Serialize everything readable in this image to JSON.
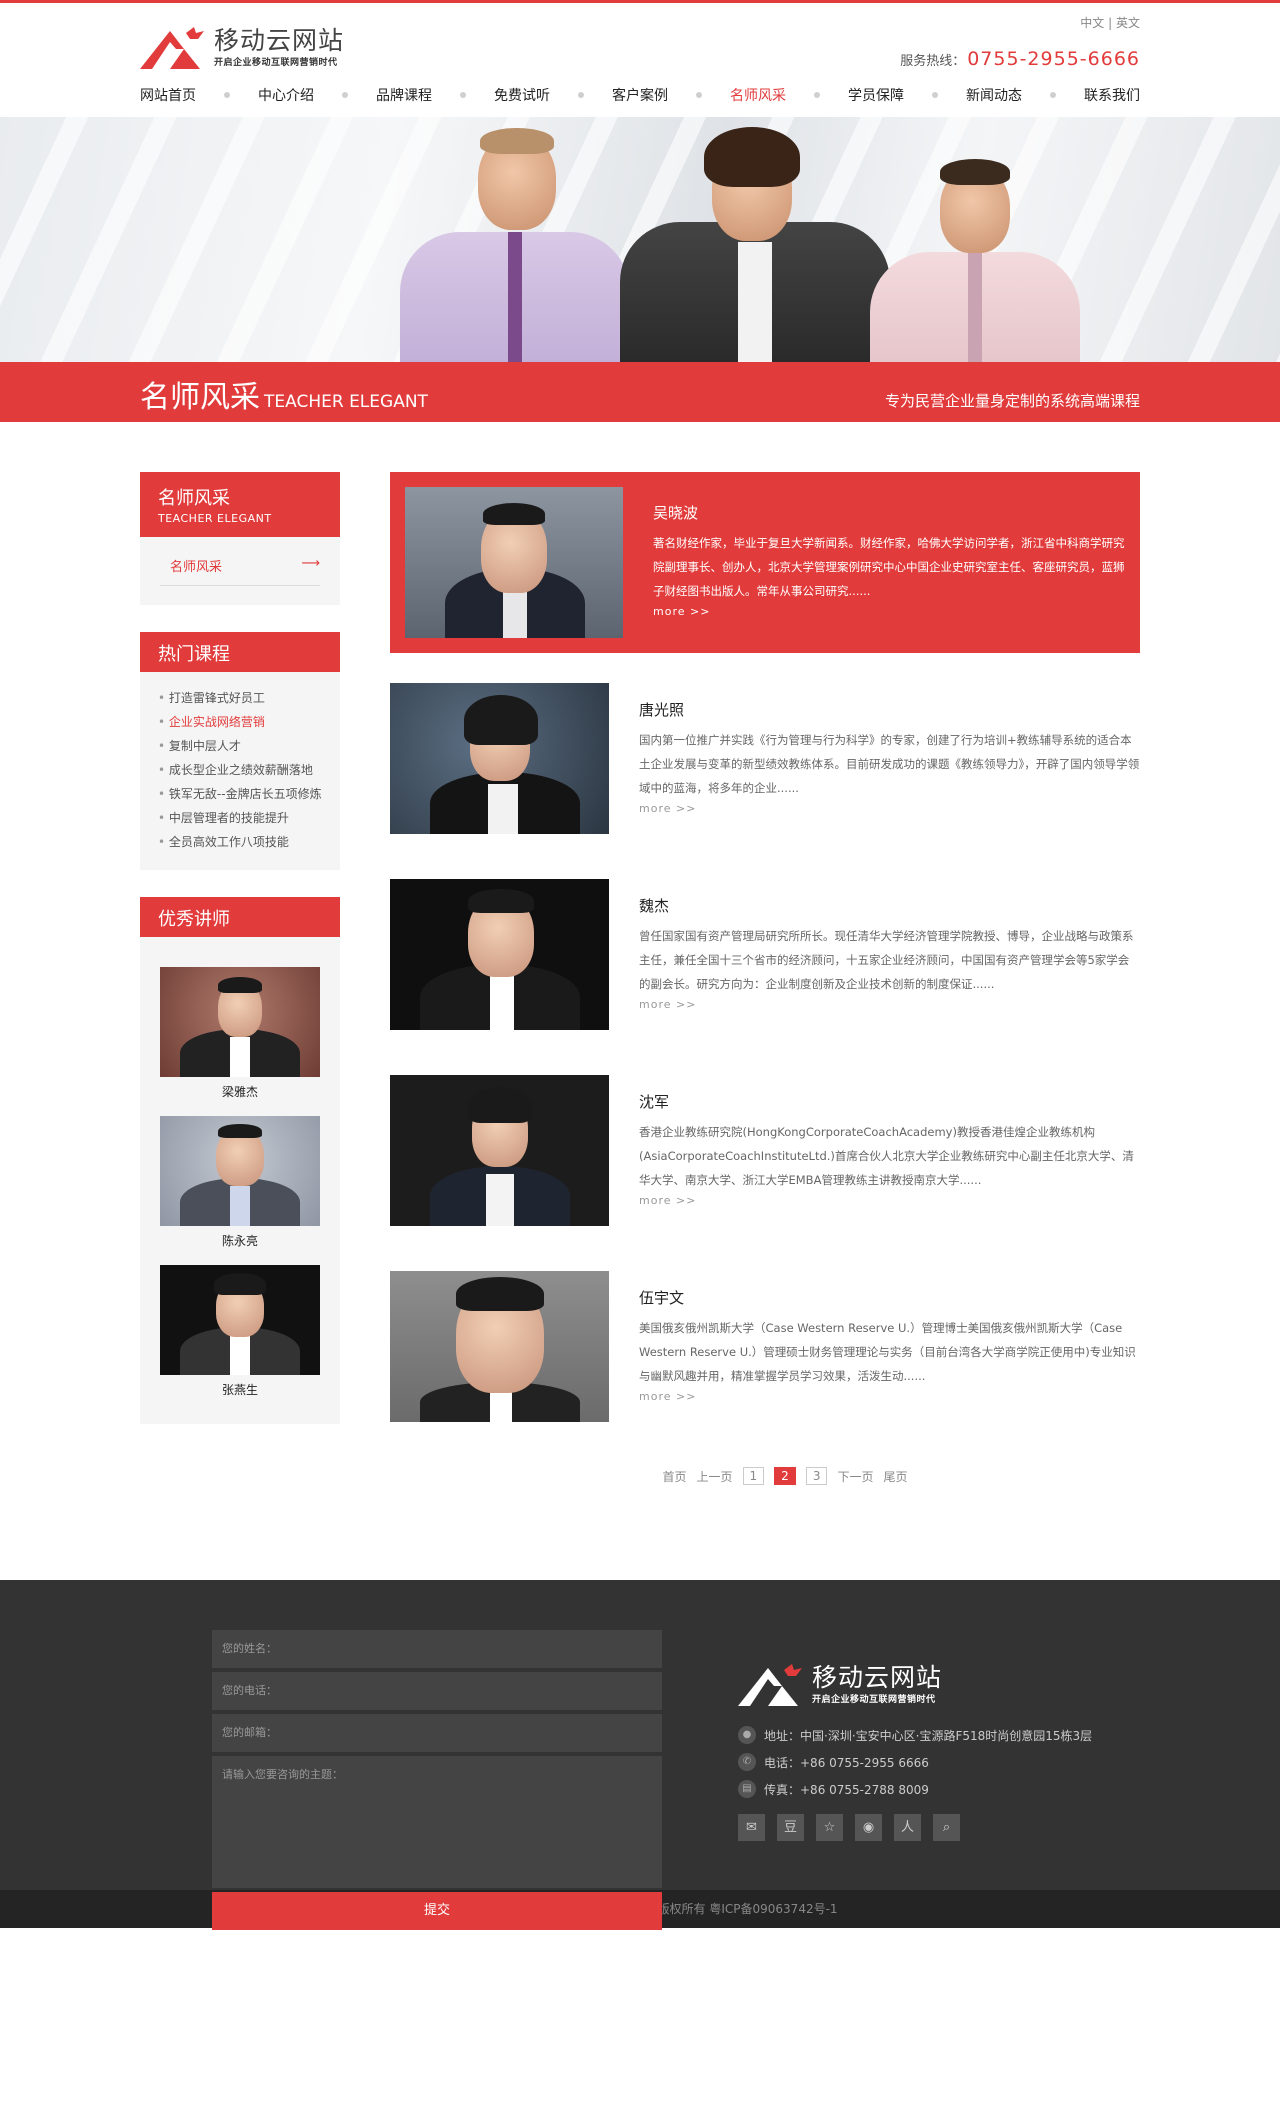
{
  "site": {
    "logo_title": "移动云网站",
    "logo_sub": "开启企业移动互联网营销时代",
    "lang_cn": "中文",
    "lang_sep": "|",
    "lang_en": "英文",
    "hotline_label": "服务热线：",
    "hotline_number": "0755-2955-6666"
  },
  "nav": [
    {
      "label": "网站首页"
    },
    {
      "label": "中心介绍"
    },
    {
      "label": "品牌课程"
    },
    {
      "label": "免费试听"
    },
    {
      "label": "客户案例"
    },
    {
      "label": "名师风采"
    },
    {
      "label": "学员保障"
    },
    {
      "label": "新闻动态"
    },
    {
      "label": "联系我们"
    }
  ],
  "banner": {
    "title": "名师风采",
    "title_en": "TEACHER ELEGANT",
    "slogan": "专为民营企业量身定制的系统高端课程"
  },
  "sidebar": {
    "section": {
      "title": "名师风采",
      "title_en": "TEACHER ELEGANT",
      "item": "名师风采",
      "arrow": "⟶"
    },
    "hot": {
      "title": "热门课程",
      "items": [
        "打造雷锋式好员工",
        "企业实战网络营销",
        "复制中层人才",
        "成长型企业之绩效薪酬落地",
        "铁军无敌--金牌店长五项修炼",
        "中层管理者的技能提升",
        "全员高效工作八项技能"
      ]
    },
    "teachers": {
      "title": "优秀讲师",
      "items": [
        "梁雅杰",
        "陈永亮",
        "张燕生"
      ]
    }
  },
  "articles": [
    {
      "name": "吴晓波",
      "desc": "著名财经作家，毕业于复旦大学新闻系。财经作家，哈佛大学访问学者，浙江省中科商学研究院副理事长、创办人，北京大学管理案例研究中心中国企业史研究室主任、客座研究员，蓝狮子财经图书出版人。常年从事公司研究......",
      "more": "more >>"
    },
    {
      "name": "唐光照",
      "desc": "国内第一位推广并实践《行为管理与行为科学》的专家，创建了行为培训+教练辅导系统的适合本土企业发展与变革的新型绩效教练体系。目前研发成功的课题《教练领导力》，开辟了国内领导学领域中的蓝海，将多年的企业......",
      "more": "more >>"
    },
    {
      "name": "魏杰",
      "desc": "曾任国家国有资产管理局研究所所长。现任清华大学经济管理学院教授、博导，企业战略与政策系主任，兼任全国十三个省市的经济顾问，十五家企业经济顾问，中国国有资产管理学会等5家学会的副会长。研究方向为：企业制度创新及企业技术创新的制度保证......",
      "more": "more >>"
    },
    {
      "name": "沈军",
      "desc": "香港企业教练研究院(HongKongCorporateCoachAcademy)教授香港佳煌企业教练机构(AsiaCorporateCoachInstituteLtd.)首席合伙人北京大学企业教练研究中心副主任北京大学、清华大学、南京大学、浙江大学EMBA管理教练主讲教授南京大学......",
      "more": "more >>"
    },
    {
      "name": "伍宇文",
      "desc": "美国俄亥俄州凯斯大学（Case Western Reserve U.）管理博士美国俄亥俄州凯斯大学（Case Western Reserve U.）管理硕士财务管理理论与实务（目前台湾各大学商学院正使用中)专业知识与幽默风趣并用，精准掌握学员学习效果，活泼生动......",
      "more": "more >>"
    }
  ],
  "pager": {
    "first": "首页",
    "prev": "上一页",
    "pages": [
      "1",
      "2",
      "3"
    ],
    "current": "2",
    "next": "下一页",
    "last": "尾页"
  },
  "footer": {
    "name_ph": "您的姓名：",
    "phone_ph": "您的电话：",
    "email_ph": "您的邮箱：",
    "topic_ph": "请输入您要咨询的主题：",
    "submit": "提交",
    "address": "地址：中国·深圳·宝安中心区·宝源路F518时尚创意园15栋3层",
    "phone": "电话：+86 0755-2955 6666",
    "fax": "传真：+86 0755-2788 8009",
    "socials": [
      "wechat-icon",
      "douban-icon",
      "star-icon",
      "weibo-icon",
      "renren-icon",
      "search-icon"
    ],
    "copyright": "Copyright ©2005 - 2014  移动云网站 版权所有     粤ICP备09063742号-1"
  },
  "colors": {
    "accent": "#e23b3b",
    "footer_bg": "#333333",
    "copy_bg": "#242424"
  }
}
